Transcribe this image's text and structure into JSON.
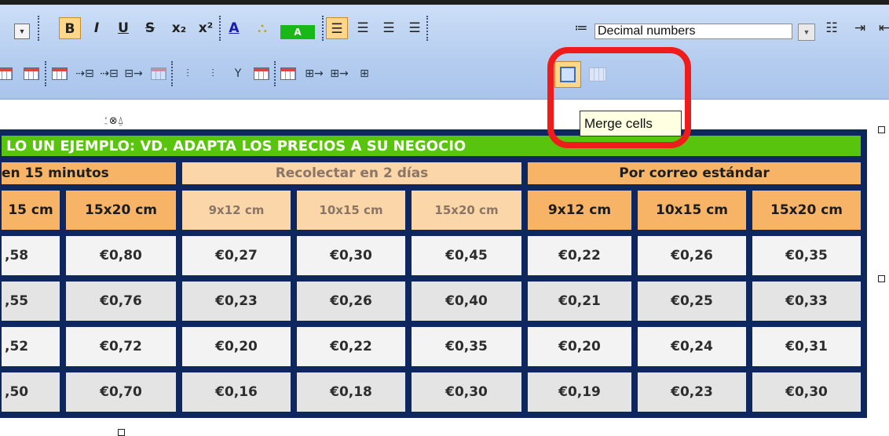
{
  "toolbar": {
    "row1": {
      "bold": "B",
      "italic": "I",
      "underline": "U",
      "strikethrough": "S",
      "subscript": "x₂",
      "superscript": "x²",
      "font_color": "A",
      "highlight_label": "A",
      "list_style_value": "Decimal numbers"
    },
    "tooltip": "Merge cells",
    "anchor_glyph": "⍘⊗⍙"
  },
  "table": {
    "title": "LO UN EJEMPLO: VD. ADAPTA LOS PRECIOS A SU NEGOCIO",
    "groups": [
      "en 15 minutos",
      "Recolectar en 2 días",
      "Por correo estándar"
    ],
    "sizes": [
      "15 cm",
      "15x20 cm",
      "9x12 cm",
      "10x15 cm",
      "15x20 cm",
      "9x12 cm",
      "10x15 cm",
      "15x20 cm"
    ],
    "rows": [
      [
        ",58",
        "€0,80",
        "€0,27",
        "€0,30",
        "€0,45",
        "€0,22",
        "€0,26",
        "€0,35"
      ],
      [
        ",55",
        "€0,76",
        "€0,23",
        "€0,26",
        "€0,40",
        "€0,21",
        "€0,25",
        "€0,33"
      ],
      [
        ",52",
        "€0,72",
        "€0,20",
        "€0,22",
        "€0,35",
        "€0,20",
        "€0,24",
        "€0,31"
      ],
      [
        ",50",
        "€0,70",
        "€0,16",
        "€0,18",
        "€0,30",
        "€0,19",
        "€0,23",
        "€0,30"
      ]
    ]
  },
  "colors": {
    "title_bg": "#58c40d",
    "header_orange": "#f7b466",
    "header_light": "#fbd6a8",
    "table_border": "#0e275e",
    "highlight_red": "#ef1c1c",
    "tooltip_bg": "#ffffe1"
  }
}
